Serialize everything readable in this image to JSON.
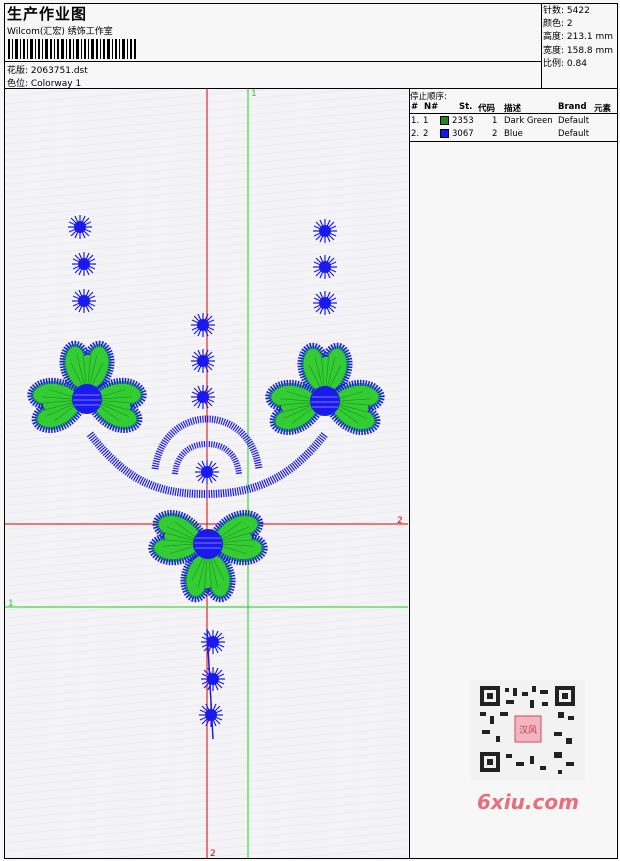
{
  "header": {
    "title": "生产作业图",
    "studio": "Wilcom(汇宏) 绣饰工作室",
    "design_label": "花版: 2063751.dst",
    "colorway_label": "色位:  Colorway 1"
  },
  "stats": {
    "stitches": "针数: 5422",
    "colors": "颜色: 2",
    "height": "高度: 213.1 mm",
    "width": "宽度: 158.8 mm",
    "scale": "比例: 0.84"
  },
  "stop_sequence": {
    "title": "停止顺序:",
    "headers": {
      "index": "#",
      "n": "N#",
      "st": "St.",
      "code": "代码",
      "desc": "描述",
      "brand": "Brand",
      "element": "元素"
    },
    "rows": [
      {
        "index": "1.",
        "n": "1",
        "color": "#1a8a1a",
        "st": "2353",
        "code": "1",
        "desc": "Dark Green",
        "brand": "Default"
      },
      {
        "index": "2.",
        "n": "2",
        "color": "#1414ee",
        "st": "3067",
        "code": "2",
        "desc": "Blue",
        "brand": "Default"
      }
    ]
  },
  "guides": {
    "green_vertical_label": "1",
    "green_horizontal_label": "1",
    "red_horizontal_label": "2",
    "red_vertical_label": "2"
  },
  "watermark": {
    "qr_stamp": "汉风",
    "site": "6xiu.com"
  },
  "colors": {
    "green": "#33cc33",
    "blue": "#1a1aee",
    "red": "#dd0000",
    "guide_green": "#22cc22"
  }
}
